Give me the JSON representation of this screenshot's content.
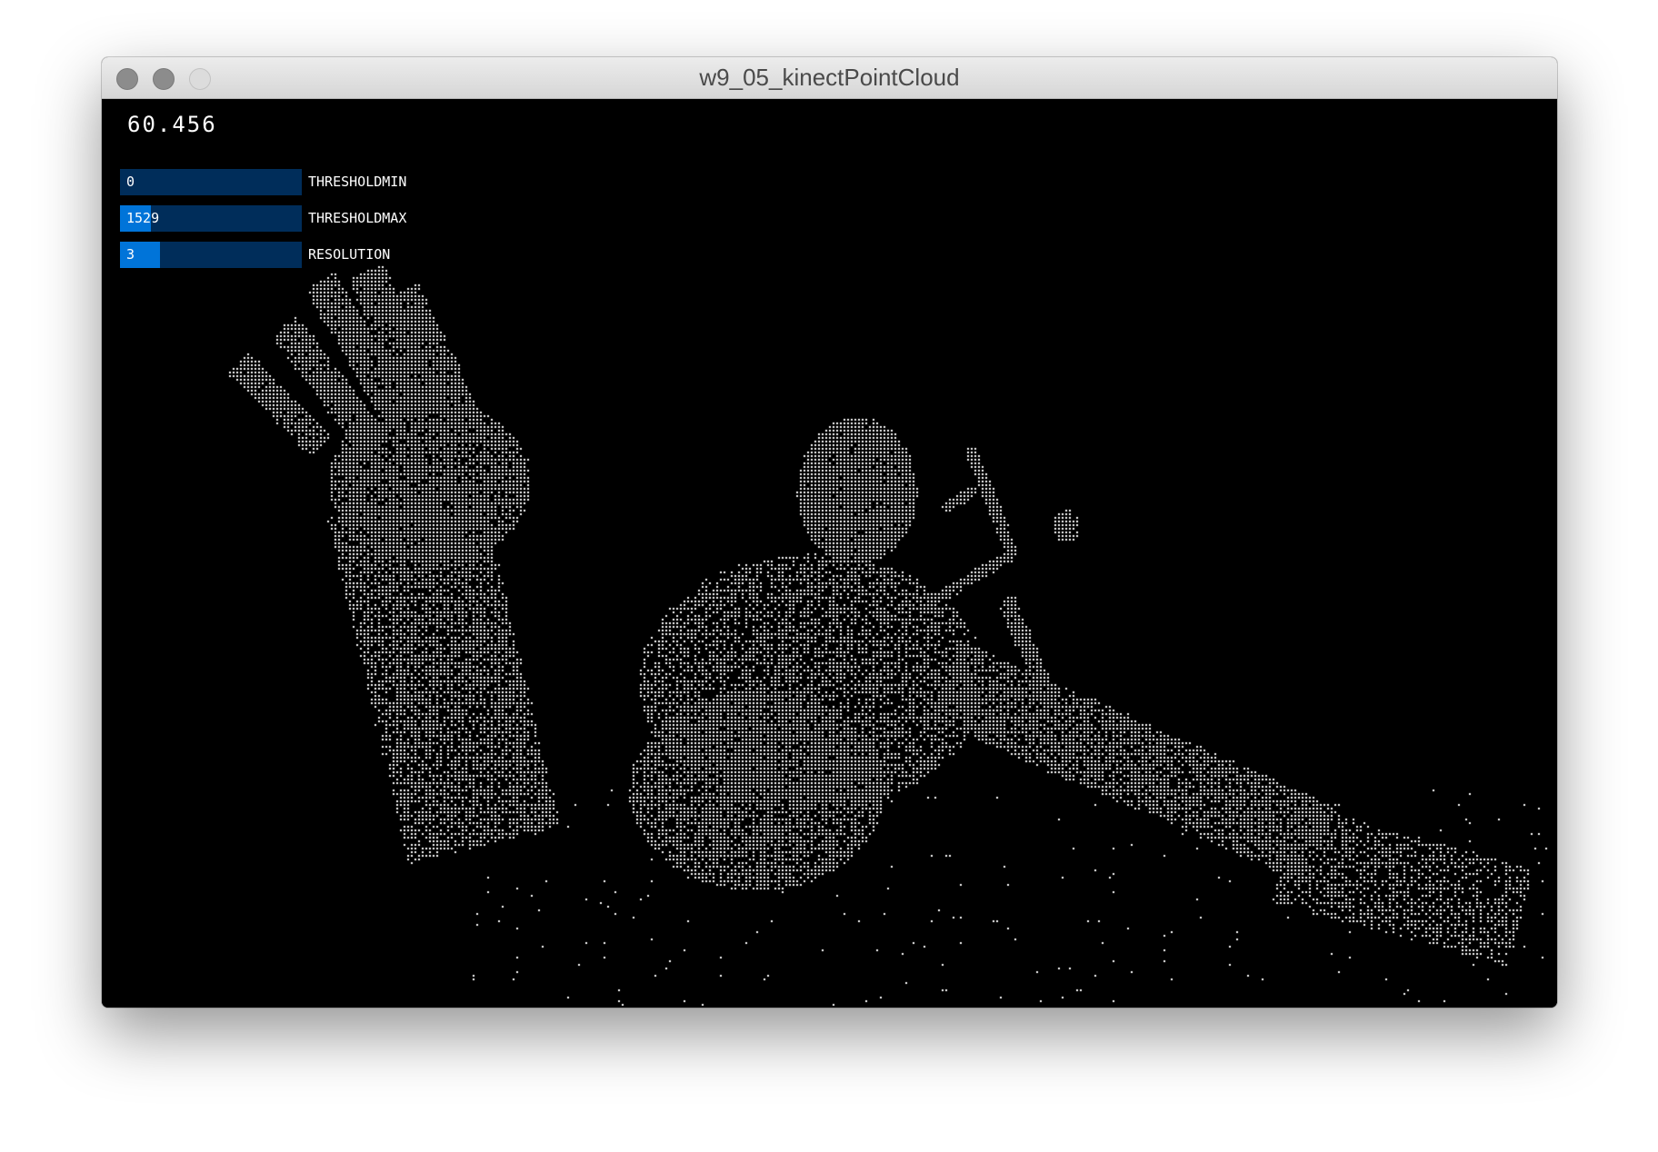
{
  "window": {
    "title": "w9_05_kinectPointCloud"
  },
  "sketch": {
    "frame_rate_text": "60.456"
  },
  "controls": [
    {
      "label": "THRESHOLDMIN",
      "value": "0",
      "fill": 0.0
    },
    {
      "label": "THRESHOLDMAX",
      "value": "1529",
      "fill": 0.17
    },
    {
      "label": "RESOLUTION",
      "value": "3",
      "fill": 0.22
    }
  ],
  "colors": {
    "slider_track": "#002d5a",
    "slider_fill": "#0074d9",
    "canvas_background": "#000000",
    "points": "#ffffff"
  }
}
